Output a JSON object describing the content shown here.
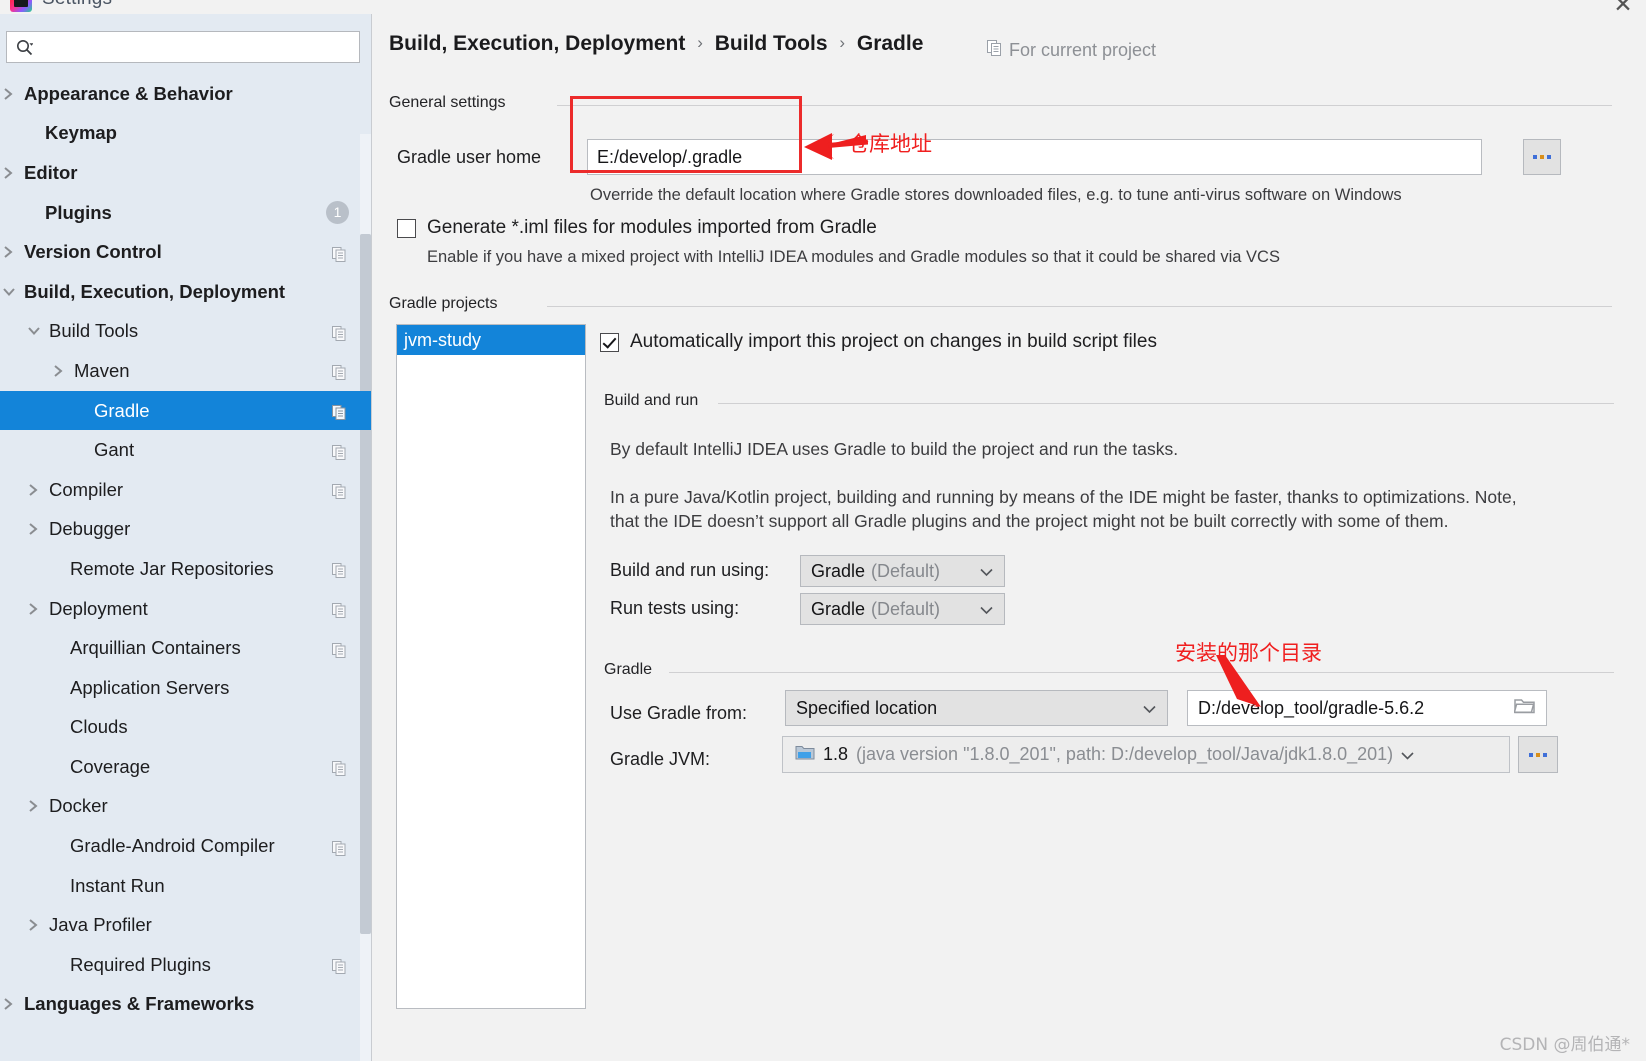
{
  "window": {
    "title": "Settings",
    "close_label": "✕",
    "logo_icon": "intellij-idea-logo"
  },
  "search": {
    "placeholder": "",
    "value": "",
    "icon": "search-icon"
  },
  "sidebar": {
    "items": [
      {
        "label": "Appearance & Behavior",
        "indent": 12,
        "arrow": "right",
        "bold": true,
        "copy": false,
        "badge": null,
        "selected": false
      },
      {
        "label": "Keymap",
        "indent": 33,
        "arrow": "none",
        "bold": true,
        "copy": false,
        "badge": null,
        "selected": false
      },
      {
        "label": "Editor",
        "indent": 12,
        "arrow": "right",
        "bold": true,
        "copy": false,
        "badge": null,
        "selected": false
      },
      {
        "label": "Plugins",
        "indent": 33,
        "arrow": "none",
        "bold": true,
        "copy": false,
        "badge": "1",
        "selected": false
      },
      {
        "label": "Version Control",
        "indent": 12,
        "arrow": "right",
        "bold": true,
        "copy": true,
        "badge": null,
        "selected": false
      },
      {
        "label": "Build, Execution, Deployment",
        "indent": 12,
        "arrow": "down",
        "bold": true,
        "copy": false,
        "badge": null,
        "selected": false
      },
      {
        "label": "Build Tools",
        "indent": 37,
        "arrow": "down",
        "bold": false,
        "copy": true,
        "badge": null,
        "selected": false
      },
      {
        "label": "Maven",
        "indent": 62,
        "arrow": "right",
        "bold": false,
        "copy": true,
        "badge": null,
        "selected": false
      },
      {
        "label": "Gradle",
        "indent": 82,
        "arrow": "none",
        "bold": false,
        "copy": true,
        "badge": null,
        "selected": true
      },
      {
        "label": "Gant",
        "indent": 82,
        "arrow": "none",
        "bold": false,
        "copy": true,
        "badge": null,
        "selected": false
      },
      {
        "label": "Compiler",
        "indent": 37,
        "arrow": "right",
        "bold": false,
        "copy": true,
        "badge": null,
        "selected": false
      },
      {
        "label": "Debugger",
        "indent": 37,
        "arrow": "right",
        "bold": false,
        "copy": false,
        "badge": null,
        "selected": false
      },
      {
        "label": "Remote Jar Repositories",
        "indent": 58,
        "arrow": "none",
        "bold": false,
        "copy": true,
        "badge": null,
        "selected": false
      },
      {
        "label": "Deployment",
        "indent": 37,
        "arrow": "right",
        "bold": false,
        "copy": true,
        "badge": null,
        "selected": false
      },
      {
        "label": "Arquillian Containers",
        "indent": 58,
        "arrow": "none",
        "bold": false,
        "copy": true,
        "badge": null,
        "selected": false
      },
      {
        "label": "Application Servers",
        "indent": 58,
        "arrow": "none",
        "bold": false,
        "copy": false,
        "badge": null,
        "selected": false
      },
      {
        "label": "Clouds",
        "indent": 58,
        "arrow": "none",
        "bold": false,
        "copy": false,
        "badge": null,
        "selected": false
      },
      {
        "label": "Coverage",
        "indent": 58,
        "arrow": "none",
        "bold": false,
        "copy": true,
        "badge": null,
        "selected": false
      },
      {
        "label": "Docker",
        "indent": 37,
        "arrow": "right",
        "bold": false,
        "copy": false,
        "badge": null,
        "selected": false
      },
      {
        "label": "Gradle-Android Compiler",
        "indent": 58,
        "arrow": "none",
        "bold": false,
        "copy": true,
        "badge": null,
        "selected": false
      },
      {
        "label": "Instant Run",
        "indent": 58,
        "arrow": "none",
        "bold": false,
        "copy": false,
        "badge": null,
        "selected": false
      },
      {
        "label": "Java Profiler",
        "indent": 37,
        "arrow": "right",
        "bold": false,
        "copy": false,
        "badge": null,
        "selected": false
      },
      {
        "label": "Required Plugins",
        "indent": 58,
        "arrow": "none",
        "bold": false,
        "copy": true,
        "badge": null,
        "selected": false
      },
      {
        "label": "Languages & Frameworks",
        "indent": 12,
        "arrow": "right",
        "bold": true,
        "copy": false,
        "badge": null,
        "selected": false
      }
    ]
  },
  "header": {
    "breadcrumb": [
      "Build, Execution, Deployment",
      "Build Tools",
      "Gradle"
    ],
    "separator": "›",
    "for_current_project": "For current project",
    "for_current_project_icon": "copy-icon"
  },
  "general_settings": {
    "group_label": "General settings",
    "gradle_user_home_label": "Gradle user home",
    "gradle_user_home_value": "E:/develop/.gradle",
    "browse_button_label": "...",
    "override_help": "Override the default location where Gradle stores downloaded files, e.g. to tune anti-virus software on Windows",
    "generate_iml_label": "Generate *.iml files for modules imported from Gradle",
    "generate_iml_checked": false,
    "generate_iml_help": "Enable if you have a mixed project with IntelliJ IDEA modules and Gradle modules so that it could be shared via VCS"
  },
  "gradle_projects": {
    "group_label": "Gradle projects",
    "projects": [
      "jvm-study"
    ],
    "selected_project": "jvm-study",
    "auto_import_label": "Automatically import this project on changes in build script files",
    "auto_import_checked": true
  },
  "build_and_run": {
    "group_label": "Build and run",
    "paragraph_1": "By default IntelliJ IDEA uses Gradle to build the project and run the tasks.",
    "paragraph_2_line_1": "In a pure Java/Kotlin project, building and running by means of the IDE might be faster, thanks to optimizations. Note,",
    "paragraph_2_line_2": "that the IDE doesn’t support all Gradle plugins and the project might not be built correctly with some of them.",
    "build_run_using_label": "Build and run using:",
    "build_run_using_value": "Gradle",
    "build_run_using_suffix": "(Default)",
    "run_tests_using_label": "Run tests using:",
    "run_tests_using_value": "Gradle",
    "run_tests_using_suffix": "(Default)"
  },
  "gradle_section": {
    "group_label": "Gradle",
    "use_gradle_from_label": "Use Gradle from:",
    "use_gradle_from_value": "Specified location",
    "gradle_home_value": "D:/develop_tool/gradle-5.6.2",
    "gradle_jvm_label": "Gradle JVM:",
    "gradle_jvm_version": "1.8",
    "gradle_jvm_detail": "(java version \"1.8.0_201\", path: D:/develop_tool/Java/jdk1.8.0_201)",
    "jvm_browse_button_label": "..."
  },
  "annotations": {
    "gradle_user_home_note": "仓库地址",
    "gradle_install_note": "安装的那个目录",
    "accent_color": "#ec2b2b"
  },
  "watermark": "CSDN @周伯通*"
}
